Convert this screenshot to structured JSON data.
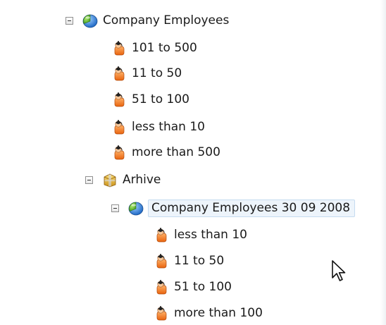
{
  "tree": {
    "root": {
      "label": "Company Employees",
      "icon": "pie-chart-icon",
      "expanded": true
    },
    "root_children": [
      {
        "label": "101 to 500",
        "icon": "employee-icon"
      },
      {
        "label": "11 to 50",
        "icon": "employee-icon"
      },
      {
        "label": "51 to 100",
        "icon": "employee-icon"
      },
      {
        "label": "less than 10",
        "icon": "employee-icon"
      },
      {
        "label": "more than 500",
        "icon": "employee-icon"
      }
    ],
    "archive": {
      "label": "Arhive",
      "icon": "archive-box-icon",
      "expanded": true
    },
    "snapshot": {
      "label": "Company Employees 30 09 2008",
      "icon": "pie-chart-icon",
      "expanded": true,
      "selected": true
    },
    "snapshot_children": [
      {
        "label": "less than 10",
        "icon": "employee-icon"
      },
      {
        "label": "11 to 50",
        "icon": "employee-icon"
      },
      {
        "label": "51 to 100",
        "icon": "employee-icon"
      },
      {
        "label": "more than 100",
        "icon": "employee-icon"
      }
    ]
  },
  "colors": {
    "selection_bg": "#edf4fb",
    "selection_border": "#c5dbf0",
    "expander_border": "#8f8f8f"
  },
  "cursor": "arrow-cursor-icon"
}
